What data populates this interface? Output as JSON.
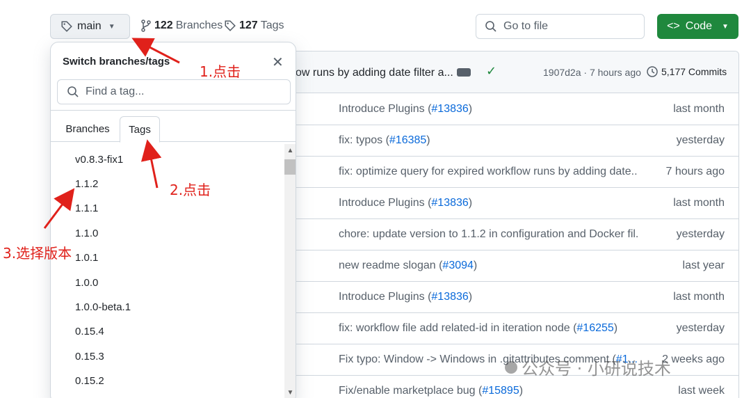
{
  "toolbar": {
    "branch_label": "main",
    "branches_count": "122",
    "branches_label": "Branches",
    "tags_count": "127",
    "tags_label": "Tags",
    "goto_placeholder": "Go to file",
    "code_label": "Code"
  },
  "commit_header": {
    "message": "ow runs by adding date filter a...",
    "sha_time": "1907d2a · 7 hours ago",
    "commits": "5,177 Commits"
  },
  "files": [
    {
      "msg": "Introduce Plugins (",
      "link": "#13836",
      "tail": ")",
      "time": "last month"
    },
    {
      "msg": "fix: typos (",
      "link": "#16385",
      "tail": ")",
      "time": "yesterday"
    },
    {
      "msg": "fix: optimize query for expired workflow runs by adding date...",
      "link": "",
      "tail": "",
      "time": "7 hours ago"
    },
    {
      "msg": "Introduce Plugins (",
      "link": "#13836",
      "tail": ")",
      "time": "last month"
    },
    {
      "msg": "chore: update version to 1.1.2 in configuration and Docker fil...",
      "link": "",
      "tail": "",
      "time": "yesterday"
    },
    {
      "msg": "new readme slogan (",
      "link": "#3094",
      "tail": ")",
      "time": "last year"
    },
    {
      "msg": "Introduce Plugins (",
      "link": "#13836",
      "tail": ")",
      "time": "last month"
    },
    {
      "msg": "fix: workflow file add related-id in iteration node (",
      "link": "#16255",
      "tail": ")",
      "time": "yesterday"
    },
    {
      "msg": "Fix typo: Window -> Windows in .gitattributes comment (",
      "link": "#1...",
      "tail": "",
      "time": "2 weeks ago"
    },
    {
      "msg": "Fix/enable marketplace bug (",
      "link": "#15895",
      "tail": ")",
      "time": "last week"
    }
  ],
  "panel": {
    "title": "Switch branches/tags",
    "search_placeholder": "Find a tag...",
    "tab_branches": "Branches",
    "tab_tags": "Tags",
    "tags": [
      "v0.8.3-fix1",
      "1.1.2",
      "1.1.1",
      "1.1.0",
      "1.0.1",
      "1.0.0",
      "1.0.0-beta.1",
      "0.15.4",
      "0.15.3",
      "0.15.2"
    ]
  },
  "annotations": {
    "step1": "1.点击",
    "step2": "2.点击",
    "step3": "3.选择版本"
  },
  "watermark": "公众号 · 小研说技术",
  "colors": {
    "code_green": "#1f883d",
    "link_blue": "#0969da",
    "annotation_red": "#e0211b"
  }
}
